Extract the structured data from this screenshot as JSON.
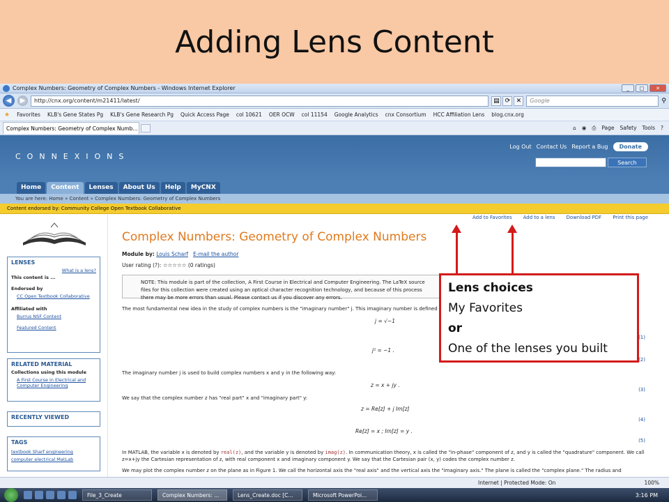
{
  "slide": {
    "title": "Adding Lens Content"
  },
  "browser": {
    "window_title": "Complex Numbers: Geometry of Complex Numbers - Windows Internet Explorer",
    "url": "http://cnx.org/content/m21411/latest/",
    "search_placeholder": "Google",
    "favorites": [
      "Favorites",
      "KLB's Gene States Pg",
      "KLB's Gene Research Pg",
      "Quick Access Page",
      "col 10621",
      "OER OCW",
      "col 11154",
      "Google Analytics",
      "cnx Consortium",
      "HCC Affiliation Lens",
      "blog.cnx.org"
    ],
    "tab_title": "Complex Numbers: Geometry of Complex Numb...",
    "commands": [
      "Page",
      "Safety",
      "Tools"
    ]
  },
  "site": {
    "logo": "CONNEXIONS",
    "top_links": [
      "Log Out",
      "Contact Us",
      "Report a Bug"
    ],
    "donate": "Donate",
    "search_button": "Search",
    "nav": [
      "Home",
      "Content",
      "Lenses",
      "About Us",
      "Help",
      "MyCNX"
    ],
    "breadcrumb": "You are here: Home » Content » Complex Numbers: Geometry of Complex Numbers",
    "endorsed_bar": "Content endorsed by: Community College Open Textbook Collaborative"
  },
  "sidebar": {
    "lenses": {
      "heading": "LENSES",
      "what_link": "What is a lens?",
      "this_content": "This content is ...",
      "endorsed_by": "Endorsed by",
      "endorsed_item": "CC Open Textbook Collaborative",
      "affiliated_with": "Affiliated with",
      "affiliated_items": [
        "Burrus NSF Content",
        "Featured Content"
      ]
    },
    "related": {
      "heading": "RELATED MATERIAL",
      "sub": "Collections using this module",
      "item": "A First Course in Electrical and Computer Engineering"
    },
    "recent": {
      "heading": "RECENTLY VIEWED"
    },
    "tags": {
      "heading": "TAGS",
      "items": "textbook  Sharf  engineering  computer  electrical  MatLab"
    }
  },
  "content": {
    "toolbar": [
      "Add to Favorites",
      "Add to a lens",
      "Download PDF",
      "Print this page"
    ],
    "title": "Complex Numbers: Geometry of Complex Numbers",
    "module_by_label": "Module by:",
    "author": "Louis Scharf",
    "email": "E-mail the author",
    "rating": "User rating (?): ☆☆☆☆☆ (0 ratings)",
    "note": "NOTE: This module is part of the collection, A First Course in Electrical and Computer Engineering. The LaTeX source files for this collection were created using an optical character recognition technology, and because of this process there may be more errors than usual. Please contact us if you discover any errors.",
    "p1": "The most fundamental new idea in the study of complex numbers is the \"imaginary number\" j. This imaginary number is defined to be the square root of -1:",
    "eq1": "j = √−1",
    "eq2": "j² = −1 .",
    "p2": "The imaginary number j is used to build complex numbers x and y in the following way:",
    "eq3": "z = x + jy .",
    "p3": "We say that the complex number z has \"real part\" x and \"imaginary part\" y:",
    "eq4": "z = Re[z] + j Im[z]",
    "eq5": "Re[z] = x ;  Im[z] = y .",
    "eqnums": [
      "(1)",
      "(2)",
      "(3)",
      "(4)",
      "(5)"
    ],
    "p4a": "In MATLAB, the variable x is denoted by",
    "p4code1": "real(z)",
    "p4b": ", and the variable y is denoted by",
    "p4code2": "imag(z)",
    "p4c": ". In communication theory, x is called the \"in-phase\" component of z, and y is called the \"quadrature\" component. We call z=x+jy the Cartesian representation of z, with real component x and imaginary component y. We say that the Cartesian pair (x, y) codes the complex number z.",
    "p5": "We may plot the complex number z on the plane as in Figure 1. We call the horizontal axis the \"real axis\" and the vertical axis the \"imaginary axis.\" The plane is called the \"complex plane.\" The radius and"
  },
  "callout": {
    "line1": "Lens choices",
    "line2": "My Favorites",
    "line3": "or",
    "line4": "One of the lenses you built"
  },
  "statusbar": {
    "zone": "Internet | Protected Mode: On",
    "zoom": "100%"
  },
  "taskbar": {
    "tasks": [
      "File_3_Create",
      "Complex Numbers: ...",
      "Lens_Create.doc [C...",
      "Microsoft PowerPoi..."
    ],
    "time": "3:16 PM"
  },
  "colors": {
    "accent": "#e07a1e",
    "callout": "#d41a1a",
    "header": "#3b6ea4",
    "endorse_bar": "#f5cc2e"
  }
}
